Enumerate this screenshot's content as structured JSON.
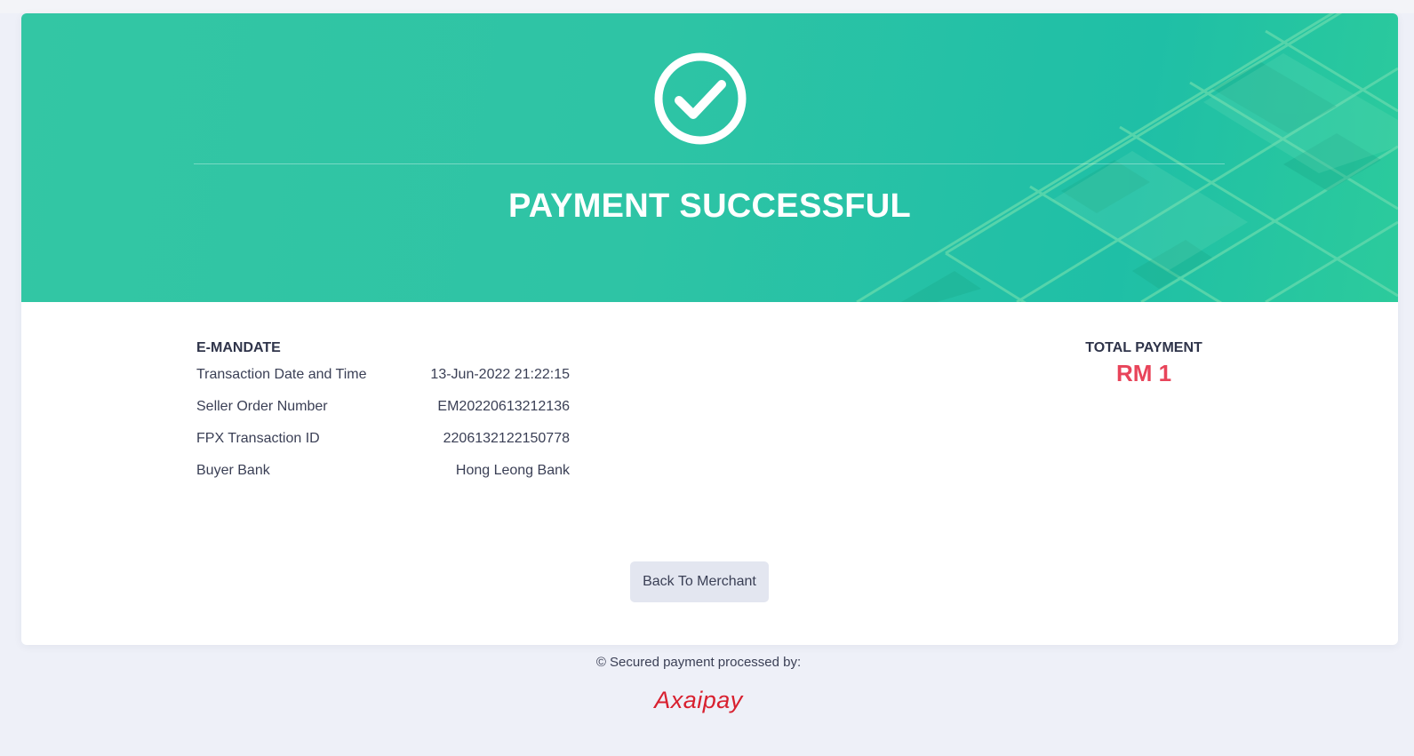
{
  "hero": {
    "title": "PAYMENT SUCCESSFUL",
    "icon": "check-circle-icon",
    "background_color": "#2ec4a5"
  },
  "details": {
    "section_title": "E-MANDATE",
    "rows": [
      {
        "label": "Transaction Date and Time",
        "value": "13-Jun-2022 21:22:15"
      },
      {
        "label": "Seller Order Number",
        "value": "EM20220613212136"
      },
      {
        "label": "FPX Transaction ID",
        "value": "2206132122150778"
      },
      {
        "label": "Buyer Bank",
        "value": "Hong Leong Bank"
      }
    ]
  },
  "total": {
    "label": "TOTAL PAYMENT",
    "amount": "RM 1",
    "amount_color": "#e8445a"
  },
  "actions": {
    "back_label": "Back To Merchant"
  },
  "footer": {
    "text": "© Secured payment processed by:",
    "brand": "Axaipay",
    "brand_color": "#d8202f"
  }
}
